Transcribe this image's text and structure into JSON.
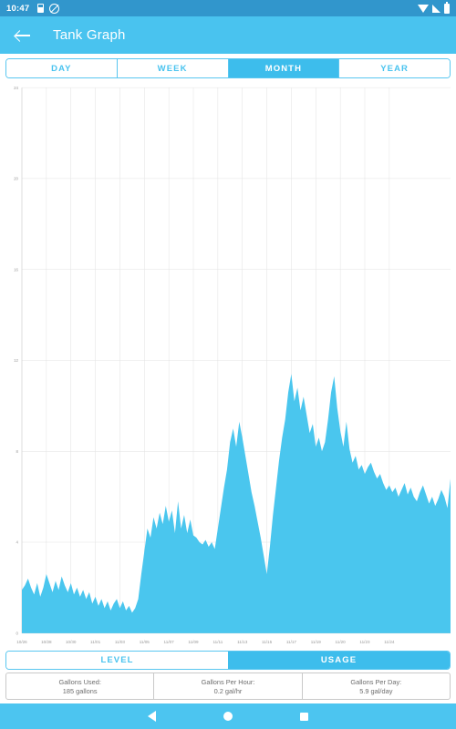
{
  "statusbar": {
    "clock": "10:47",
    "icons_left": [
      "sim-card-icon",
      "no-image-icon"
    ],
    "icons_right": [
      "wifi-icon",
      "signal-icon",
      "battery-icon"
    ]
  },
  "appbar": {
    "back_icon": "back-arrow-icon",
    "title": "Tank Graph"
  },
  "range_tabs": {
    "items": [
      {
        "label": "DAY",
        "active": false
      },
      {
        "label": "WEEK",
        "active": false
      },
      {
        "label": "MONTH",
        "active": true
      },
      {
        "label": "YEAR",
        "active": false
      }
    ]
  },
  "mode_tabs": {
    "items": [
      {
        "label": "LEVEL",
        "active": false
      },
      {
        "label": "USAGE",
        "active": true
      }
    ]
  },
  "stats": [
    {
      "label": "Gallons Used:",
      "value": "185 gallons"
    },
    {
      "label": "Gallons Per Hour:",
      "value": "0.2 gal/hr"
    },
    {
      "label": "Gallons Per Day:",
      "value": "5.9 gal/day"
    }
  ],
  "navbar": {
    "back": "nav-back-icon",
    "home": "nav-home-icon",
    "recent": "nav-recent-icon"
  },
  "colors": {
    "statusbar": "#3196cc",
    "appbar": "#49c3ef",
    "accent": "#3dbdec",
    "chart_fill": "#4ac6ee",
    "grid": "#e2e2e2",
    "navbar": "#4cc5f0"
  },
  "chart_data": {
    "type": "area",
    "title": "",
    "xlabel": "",
    "ylabel": "",
    "ylim": [
      0,
      24
    ],
    "yticks": [
      0,
      4,
      8,
      12,
      16,
      20,
      24
    ],
    "ytick_labels": [
      "0",
      "4",
      "8",
      "12",
      "16",
      "20",
      "24"
    ],
    "grid": true,
    "legend": "none",
    "xtick_labels": [
      "10/26",
      "10/28",
      "10/30",
      "11/01",
      "11/03",
      "11/05",
      "11/07",
      "11/09",
      "11/11",
      "11/13",
      "11/15",
      "11/17",
      "11/19",
      "11/20",
      "11/23",
      "11/24"
    ],
    "xtick_index": [
      0,
      8,
      16,
      24,
      32,
      40,
      48,
      56,
      64,
      72,
      80,
      88,
      96,
      104,
      112,
      120
    ],
    "series": [
      {
        "name": "Usage",
        "values": [
          1.9,
          2.1,
          2.4,
          2.0,
          1.7,
          2.2,
          1.6,
          2.0,
          2.6,
          2.2,
          1.8,
          2.3,
          1.9,
          2.5,
          2.1,
          1.8,
          2.2,
          1.7,
          2.0,
          1.6,
          1.9,
          1.5,
          1.8,
          1.3,
          1.6,
          1.2,
          1.5,
          1.1,
          1.4,
          1.0,
          1.3,
          1.5,
          1.1,
          1.4,
          1.0,
          1.2,
          0.9,
          1.1,
          1.5,
          2.6,
          3.6,
          4.6,
          4.2,
          5.1,
          4.6,
          5.3,
          4.8,
          5.6,
          4.9,
          5.4,
          4.4,
          5.8,
          4.6,
          5.2,
          4.4,
          5.0,
          4.3,
          4.2,
          4.0,
          3.9,
          4.1,
          3.8,
          4.0,
          3.7,
          4.6,
          5.5,
          6.4,
          7.2,
          8.4,
          9.0,
          8.2,
          9.3,
          8.6,
          7.8,
          7.0,
          6.2,
          5.6,
          4.9,
          4.2,
          3.4,
          2.6,
          3.8,
          5.2,
          6.4,
          7.6,
          8.6,
          9.4,
          10.6,
          11.4,
          10.2,
          10.8,
          9.8,
          10.4,
          9.6,
          8.8,
          9.2,
          8.2,
          8.6,
          8.0,
          8.4,
          9.4,
          10.6,
          11.3,
          9.9,
          8.9,
          8.2,
          9.3,
          8.1,
          7.5,
          7.8,
          7.2,
          7.4,
          7.0,
          7.3,
          7.5,
          7.1,
          6.8,
          7.0,
          6.6,
          6.3,
          6.5,
          6.2,
          6.4,
          6.0,
          6.3,
          6.6,
          6.1,
          6.4,
          6.0,
          5.8,
          6.2,
          6.5,
          6.1,
          5.7,
          6.0,
          5.6,
          5.9,
          6.3,
          6.0,
          5.5,
          6.8
        ]
      }
    ]
  }
}
